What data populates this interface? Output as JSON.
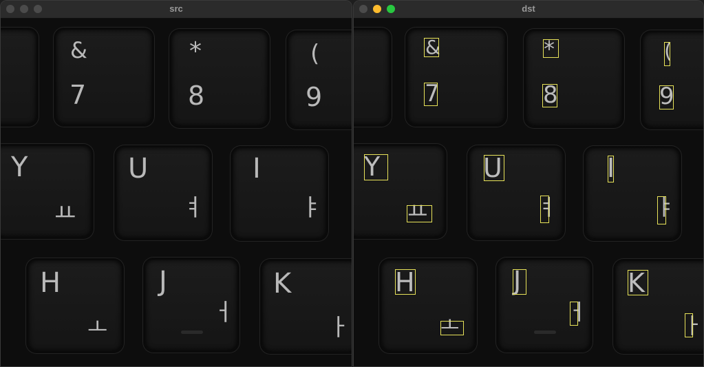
{
  "windows": {
    "src": {
      "title": "src"
    },
    "dst": {
      "title": "dst"
    }
  },
  "controls": {
    "close_color": "#ff5f57",
    "minimize_color": "#febc2e",
    "maximize_color": "#28c840",
    "inactive_color": "#4b4b4b"
  },
  "detection_box_color": "#e9e45a",
  "keys": {
    "k7": {
      "top": "&",
      "bottom": "7"
    },
    "k8": {
      "top": "*",
      "bottom": "8"
    },
    "k9": {
      "top": "(",
      "bottom": "9"
    },
    "kY": {
      "latin": "Y",
      "hangul": "ㅛ"
    },
    "kU": {
      "latin": "U",
      "hangul": "ㅕ"
    },
    "kI": {
      "latin": "I",
      "hangul": "ㅑ"
    },
    "kH": {
      "latin": "H",
      "hangul": "ㅗ"
    },
    "kJ": {
      "latin": "J",
      "hangul": "ㅓ"
    },
    "kK": {
      "latin": "K",
      "hangul": "ㅏ"
    }
  }
}
